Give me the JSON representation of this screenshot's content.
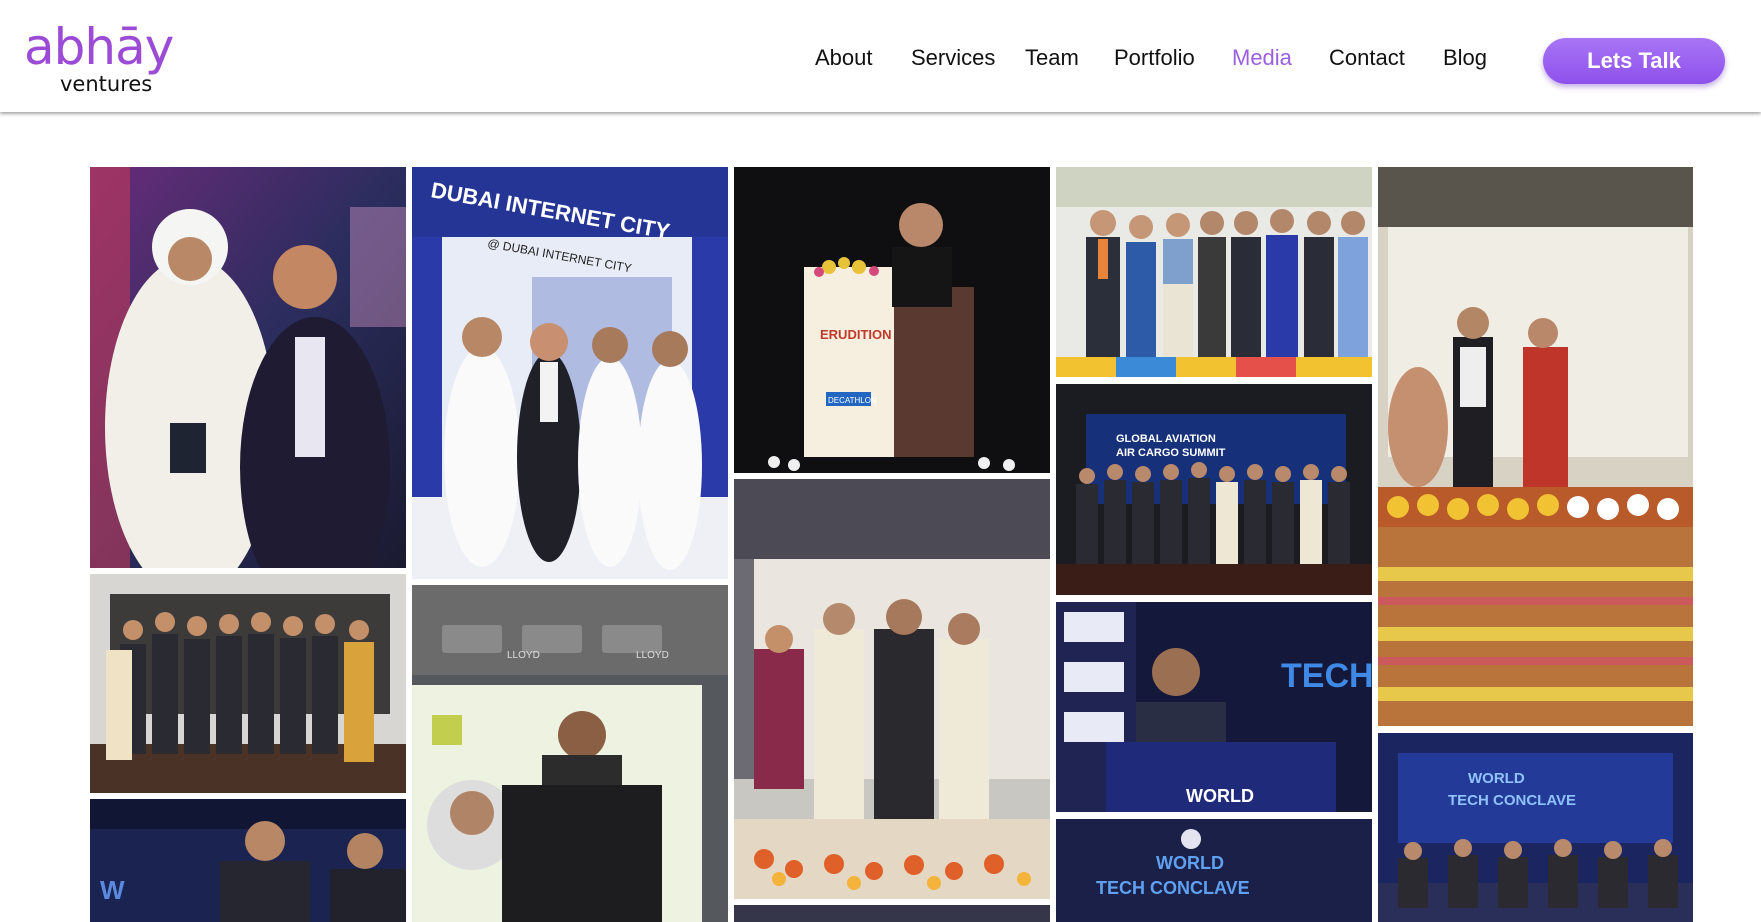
{
  "brand": {
    "name": "abhāy",
    "sub": "ventures",
    "color": "#9b4bd6"
  },
  "nav": {
    "items": [
      {
        "label": "About",
        "active": false
      },
      {
        "label": "Services",
        "active": false
      },
      {
        "label": "Team",
        "active": false
      },
      {
        "label": "Portfolio",
        "active": false
      },
      {
        "label": "Media",
        "active": true
      },
      {
        "label": "Contact",
        "active": false
      },
      {
        "label": "Blog",
        "active": false
      }
    ],
    "cta_label": "Lets Talk",
    "active_color": "#9b5fe0"
  },
  "gallery": {
    "photos": [
      {
        "sign": "",
        "sign2": ""
      },
      {
        "sign": "DUBAI INTERNET CITY",
        "sign2": "@ DUBAI INTERNET CITY"
      },
      {
        "sign": "ERUDITION",
        "sign2": "DECATHLON"
      },
      {
        "sign": "",
        "sign2": ""
      },
      {
        "sign": "",
        "sign2": ""
      },
      {
        "sign": "",
        "sign2": ""
      },
      {
        "sign": "LLOYD",
        "sign2": "LLOYD"
      },
      {
        "sign": "",
        "sign2": ""
      },
      {
        "sign": "GLOBAL AVIATION",
        "sign2": "AIR CARGO SUMMIT"
      },
      {
        "sign": "TECH",
        "sign2": "WORLD"
      },
      {
        "sign": "WORLD",
        "sign2": "TECH CONCLAVE"
      },
      {
        "sign": "WORLD",
        "sign2": "TECH CONCLAVE"
      },
      {
        "sign": "WORLD",
        "sign2": "TECH CONCLAVE"
      },
      {
        "sign": "",
        "sign2": ""
      }
    ]
  }
}
